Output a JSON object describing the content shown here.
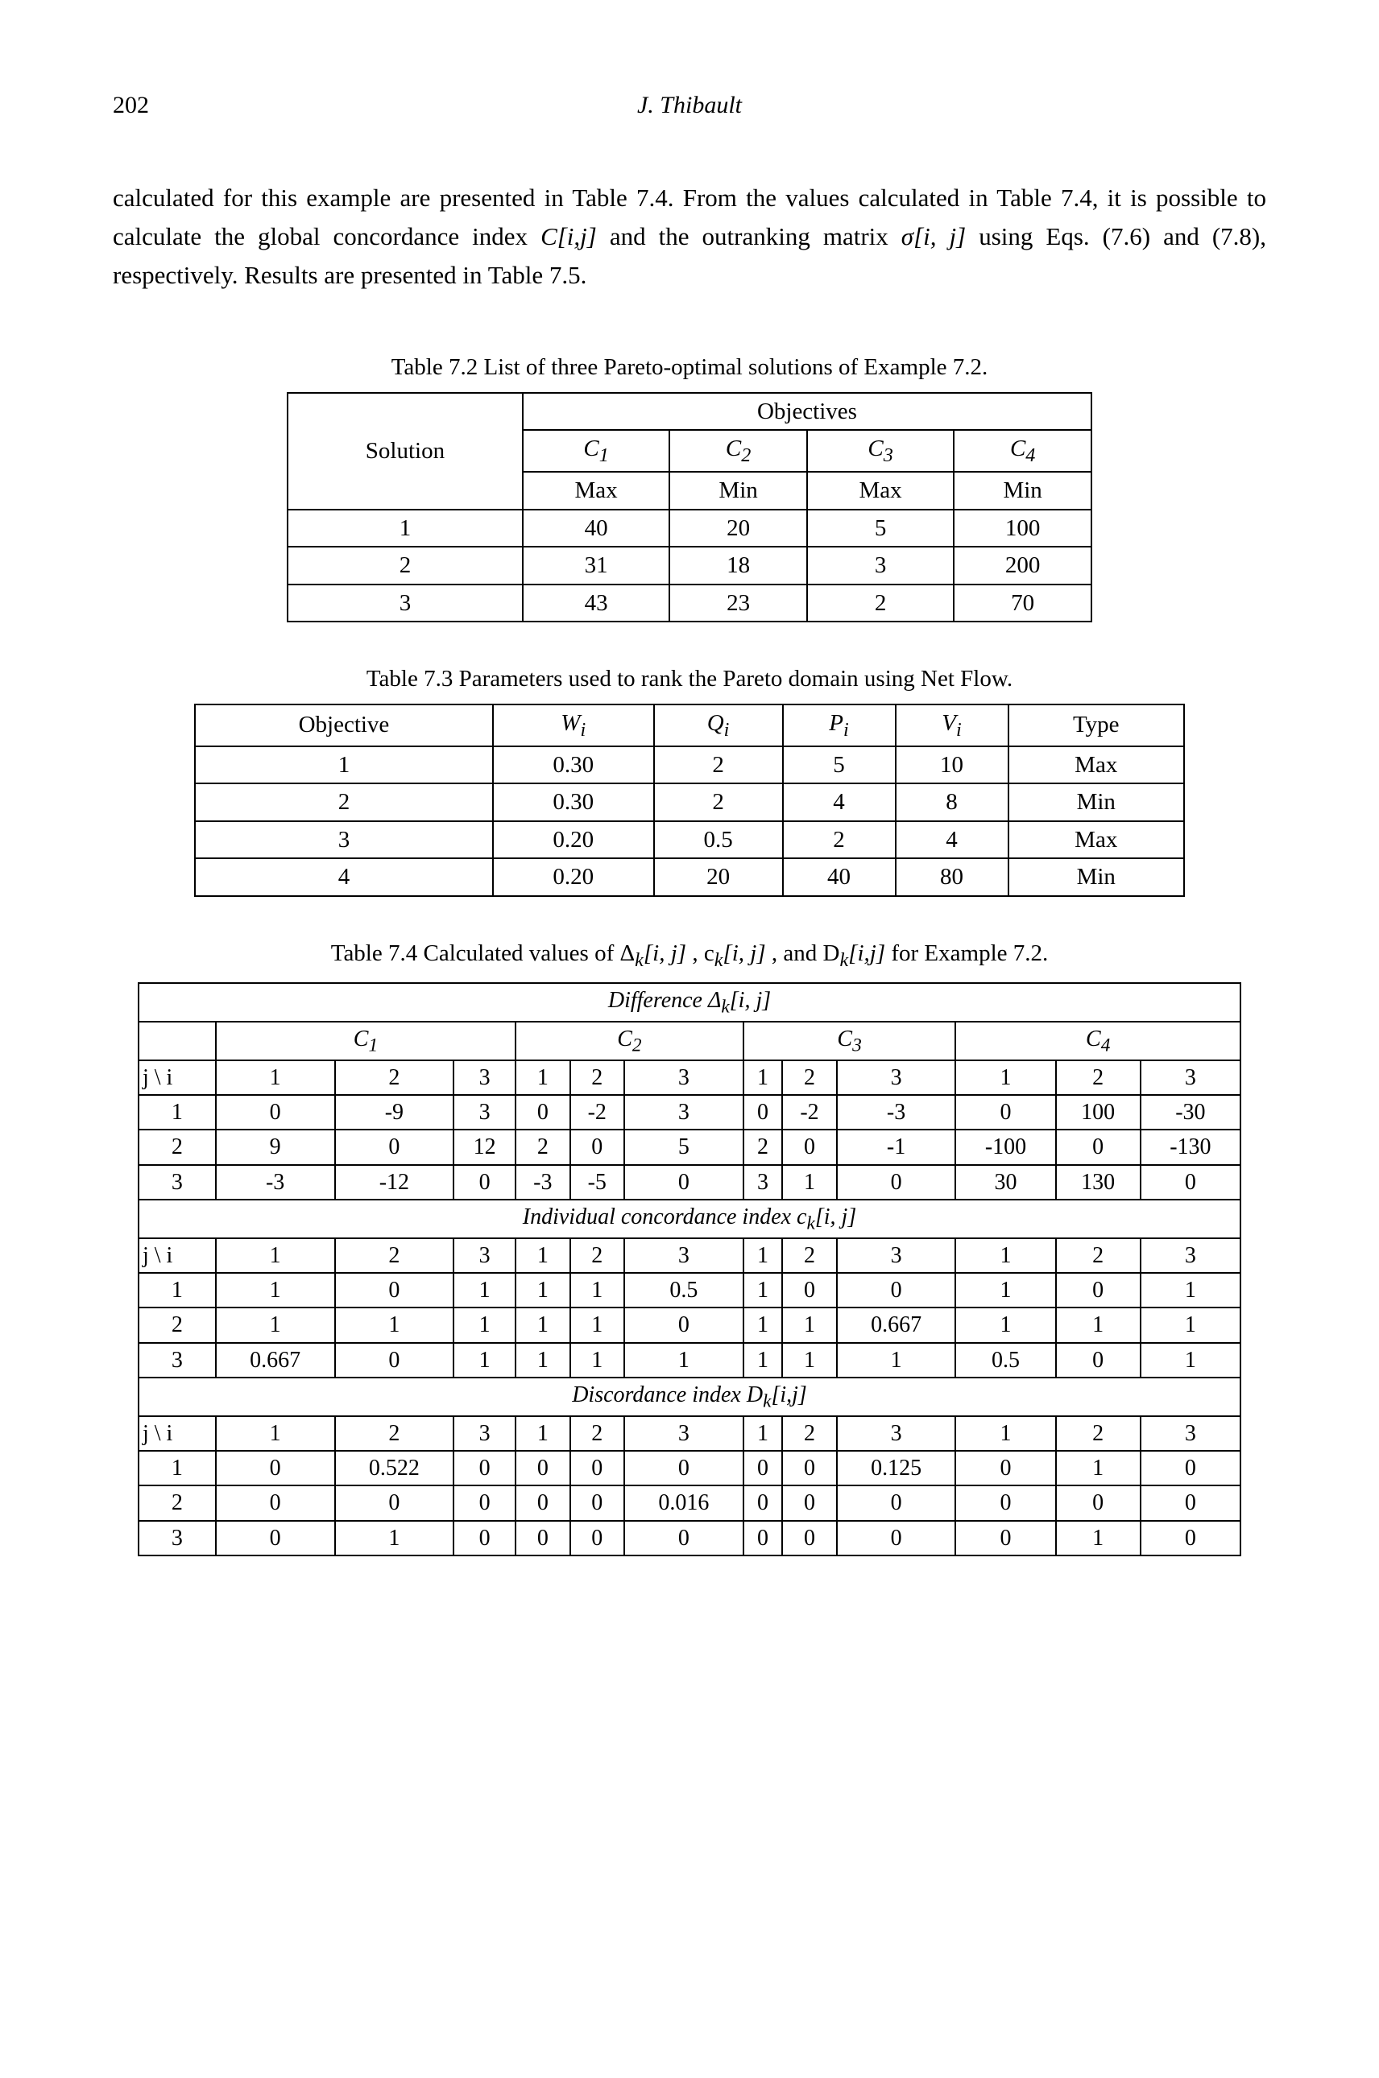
{
  "page_number": "202",
  "author": "J. Thibault",
  "paragraph": {
    "t1": "calculated for this example are presented in Table 7.4. From the values calculated in Table 7.4, it is possible to calculate the global concordance index ",
    "ci": "C[i,j]",
    "t2": " and the outranking matrix ",
    "sigma": "σ[i, j]",
    "t3": " using Eqs. (7.6) and (7.8), respectively. Results are presented in Table 7.5."
  },
  "table72": {
    "caption": "Table 7.2  List of three Pareto-optimal solutions of Example 7.2.",
    "h_solution": "Solution",
    "h_objectives": "Objectives",
    "c1": "C",
    "s1": "1",
    "c2": "C",
    "s2": "2",
    "c3": "C",
    "s3": "3",
    "c4": "C",
    "s4": "4",
    "max": "Max",
    "min": "Min",
    "rows": [
      {
        "sol": "1",
        "v": [
          "40",
          "20",
          "5",
          "100"
        ]
      },
      {
        "sol": "2",
        "v": [
          "31",
          "18",
          "3",
          "200"
        ]
      },
      {
        "sol": "3",
        "v": [
          "43",
          "23",
          "2",
          "70"
        ]
      }
    ]
  },
  "table73": {
    "caption": "Table 7.3  Parameters used to rank the Pareto domain using Net Flow.",
    "h": {
      "obj": "Objective",
      "w": "W",
      "q": "Q",
      "p": "P",
      "v": "V",
      "type": "Type",
      "i": "i"
    },
    "rows": [
      {
        "obj": "1",
        "w": "0.30",
        "q": "2",
        "p": "5",
        "v": "10",
        "t": "Max"
      },
      {
        "obj": "2",
        "w": "0.30",
        "q": "2",
        "p": "4",
        "v": "8",
        "t": "Min"
      },
      {
        "obj": "3",
        "w": "0.20",
        "q": "0.5",
        "p": "2",
        "v": "4",
        "t": "Max"
      },
      {
        "obj": "4",
        "w": "0.20",
        "q": "20",
        "p": "40",
        "v": "80",
        "t": "Min"
      }
    ]
  },
  "table74": {
    "caption_pre": "Table 7.4  Calculated values of  Δ",
    "caption_k": "k",
    "caption_ij1": "[i, j]",
    "caption_mid": " ,  c",
    "caption_ij2": "[i, j]",
    "caption_post": " , and D",
    "caption_ij3": "[i,j]",
    "caption_end": " for Example 7.2.",
    "sec1": "Difference  Δ",
    "sec1_ij": "[i, j]",
    "sec2": "Individual concordance index  c",
    "sec2_ij": "[i, j]",
    "sec3": "Discordance index D",
    "sec3_ij": "[i,j]",
    "C": "C",
    "c1": "1",
    "c2": "2",
    "c3": "3",
    "c4": "4",
    "ji": "j \\ i",
    "cols": [
      "1",
      "2",
      "3",
      "1",
      "2",
      "3",
      "1",
      "2",
      "3",
      "1",
      "2",
      "3"
    ],
    "diff": [
      {
        "j": "1",
        "v": [
          "0",
          "-9",
          "3",
          "0",
          "-2",
          "3",
          "0",
          "-2",
          "-3",
          "0",
          "100",
          "-30"
        ]
      },
      {
        "j": "2",
        "v": [
          "9",
          "0",
          "12",
          "2",
          "0",
          "5",
          "2",
          "0",
          "-1",
          "-100",
          "0",
          "-130"
        ]
      },
      {
        "j": "3",
        "v": [
          "-3",
          "-12",
          "0",
          "-3",
          "-5",
          "0",
          "3",
          "1",
          "0",
          "30",
          "130",
          "0"
        ]
      }
    ],
    "conc": [
      {
        "j": "1",
        "v": [
          "1",
          "0",
          "1",
          "1",
          "1",
          "0.5",
          "1",
          "0",
          "0",
          "1",
          "0",
          "1"
        ]
      },
      {
        "j": "2",
        "v": [
          "1",
          "1",
          "1",
          "1",
          "1",
          "0",
          "1",
          "1",
          "0.667",
          "1",
          "1",
          "1"
        ]
      },
      {
        "j": "3",
        "v": [
          "0.667",
          "0",
          "1",
          "1",
          "1",
          "1",
          "1",
          "1",
          "1",
          "0.5",
          "0",
          "1"
        ]
      }
    ],
    "disc": [
      {
        "j": "1",
        "v": [
          "0",
          "0.522",
          "0",
          "0",
          "0",
          "0",
          "0",
          "0",
          "0.125",
          "0",
          "1",
          "0"
        ]
      },
      {
        "j": "2",
        "v": [
          "0",
          "0",
          "0",
          "0",
          "0",
          "0.016",
          "0",
          "0",
          "0",
          "0",
          "0",
          "0"
        ]
      },
      {
        "j": "3",
        "v": [
          "0",
          "1",
          "0",
          "0",
          "0",
          "0",
          "0",
          "0",
          "0",
          "0",
          "1",
          "0"
        ]
      }
    ]
  }
}
